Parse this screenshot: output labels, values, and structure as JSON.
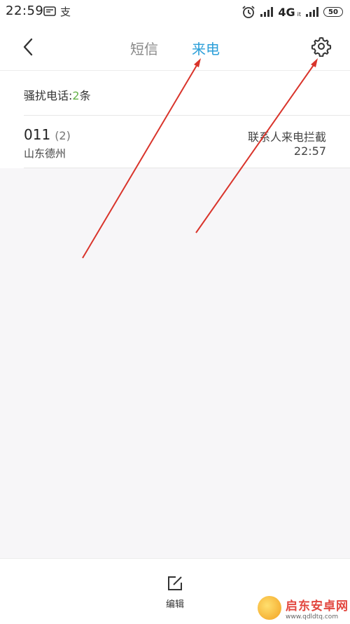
{
  "status_bar": {
    "time": "22:59",
    "network": "4G",
    "network_sub": "it",
    "battery": "50",
    "icons": [
      "message-icon",
      "alipay-icon",
      "alarm-icon",
      "signal-icon",
      "signal-icon",
      "battery-icon"
    ]
  },
  "header": {
    "tabs": [
      {
        "label": "短信",
        "active": false
      },
      {
        "label": "来电",
        "active": true
      }
    ],
    "active_color": "#2c9fd9"
  },
  "summary": {
    "label": "骚扰电话:",
    "count": "2",
    "unit": "条",
    "count_color": "#66b24a"
  },
  "calls": [
    {
      "number": "011",
      "count": "(2)",
      "location": "山东德州",
      "tag": "联系人来电拦截",
      "time": "22:57"
    }
  ],
  "bottom_bar": {
    "edit_label": "编辑"
  },
  "annotation": {
    "arrow_color": "#d9342b"
  },
  "watermark": {
    "title": "启东安卓网",
    "url": "www.qdldtq.com"
  }
}
